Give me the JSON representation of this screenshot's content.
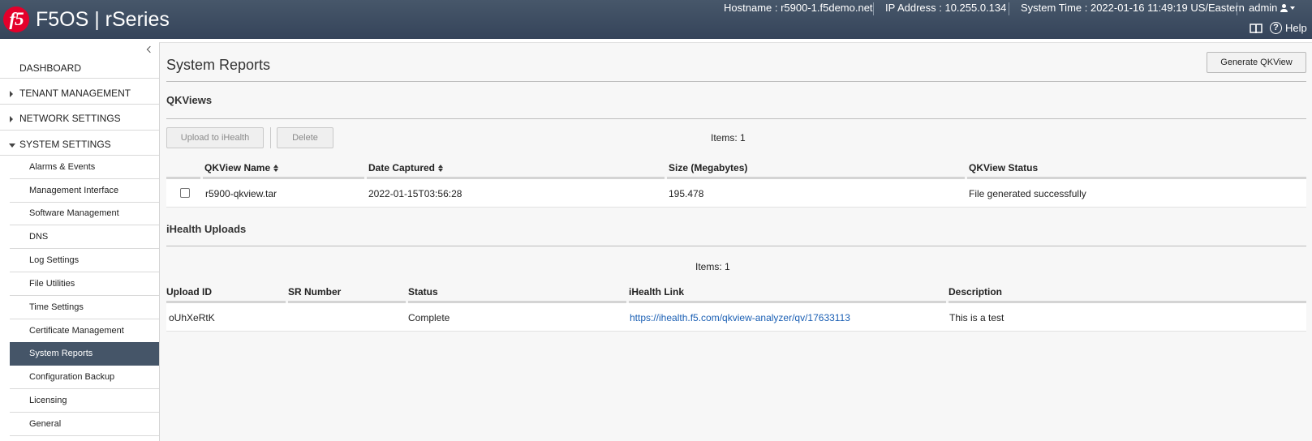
{
  "header": {
    "logo_text": "f5",
    "brand": "F5OS | rSeries",
    "hostname": "Hostname : r5900-1.f5demo.net",
    "ip_address": "IP Address : 10.255.0.134",
    "system_time": "System Time : 2022-01-16 11:49:19 US/Eastern",
    "user": "admin",
    "help_label": "Help"
  },
  "sidebar": {
    "top_items": [
      {
        "label": "DASHBOARD",
        "icon": "none"
      },
      {
        "label": "TENANT MANAGEMENT",
        "icon": "caret-right"
      },
      {
        "label": "NETWORK SETTINGS",
        "icon": "caret-right"
      },
      {
        "label": "SYSTEM SETTINGS",
        "icon": "caret-down"
      }
    ],
    "sub_items": [
      {
        "label": "Alarms & Events"
      },
      {
        "label": "Management Interface"
      },
      {
        "label": "Software Management"
      },
      {
        "label": "DNS"
      },
      {
        "label": "Log Settings"
      },
      {
        "label": "File Utilities"
      },
      {
        "label": "Time Settings"
      },
      {
        "label": "Certificate Management"
      },
      {
        "label": "System Reports",
        "active": true
      },
      {
        "label": "Configuration Backup"
      },
      {
        "label": "Licensing"
      },
      {
        "label": "General"
      }
    ]
  },
  "main": {
    "title": "System Reports",
    "generate_button": "Generate QKView",
    "qkviews": {
      "title": "QKViews",
      "upload_button": "Upload to iHealth",
      "delete_button": "Delete",
      "items_count": "Items: 1",
      "columns": [
        "QKView Name",
        "Date Captured",
        "Size (Megabytes)",
        "QKView Status"
      ],
      "rows": [
        {
          "name": "r5900-qkview.tar",
          "date": "2022-01-15T03:56:28",
          "size": "195.478",
          "status": "File generated successfully",
          "checked": false
        }
      ]
    },
    "ihealth": {
      "title": "iHealth Uploads",
      "items_count": "Items: 1",
      "columns": [
        "Upload ID",
        "SR Number",
        "Status",
        "iHealth Link",
        "Description"
      ],
      "rows": [
        {
          "upload_id": "oUhXeRtK",
          "sr_number": "",
          "status": "Complete",
          "link": "https://ihealth.f5.com/qkview-analyzer/qv/17633113",
          "description": "This is a test"
        }
      ]
    }
  },
  "colors": {
    "header_bg": "#3d4d61",
    "active_nav": "#455568",
    "brand_red": "#e4002b",
    "link": "#1a5fb4"
  }
}
